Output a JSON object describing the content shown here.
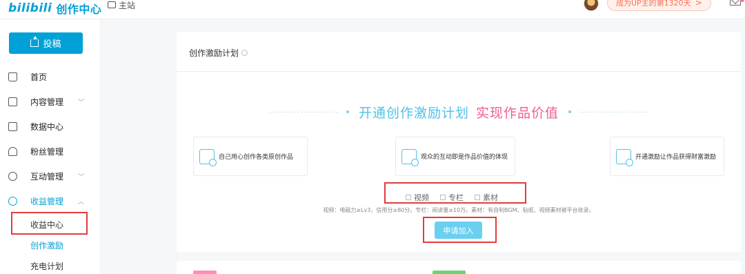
{
  "header": {
    "logo_brand": "bilibili",
    "logo_sub": "创作中心",
    "main_site": "主站",
    "up_badge": "成为UP主的第1320天",
    "up_badge_arrow": ">"
  },
  "sidebar": {
    "upload_label": "投稿",
    "items": [
      {
        "label": "首页",
        "chevron": ""
      },
      {
        "label": "内容管理",
        "chevron": "﹀"
      },
      {
        "label": "数据中心",
        "chevron": ""
      },
      {
        "label": "粉丝管理",
        "chevron": ""
      },
      {
        "label": "互动管理",
        "chevron": "﹀"
      },
      {
        "label": "收益管理",
        "chevron": "︿"
      }
    ],
    "sub_items": [
      {
        "label": "收益中心"
      },
      {
        "label": "创作激励"
      },
      {
        "label": "充电计划"
      }
    ]
  },
  "card": {
    "title": "创作激励计划",
    "slogan_part1": "开通创作激励计划",
    "slogan_part2": "实现作品价值",
    "features": [
      {
        "label": "自己用心创作各类原创作品"
      },
      {
        "label": "观众的互动即是作品价值的体现"
      },
      {
        "label": "开通激励让作品获得财富激励"
      }
    ],
    "checkboxes": [
      {
        "label": "视频"
      },
      {
        "label": "专栏"
      },
      {
        "label": "素材"
      }
    ],
    "requirement_note": "视频：电磁力≥Lv3，信用分≥80分。专栏：阅读量≥10万。素材：有自制BGM、贴纸、视频素材被平台收录。",
    "apply_button": "申请加入"
  },
  "colors": {
    "accent": "#00a1d6",
    "pink": "#f25d8e",
    "highlight_box": "#e23b3b"
  }
}
